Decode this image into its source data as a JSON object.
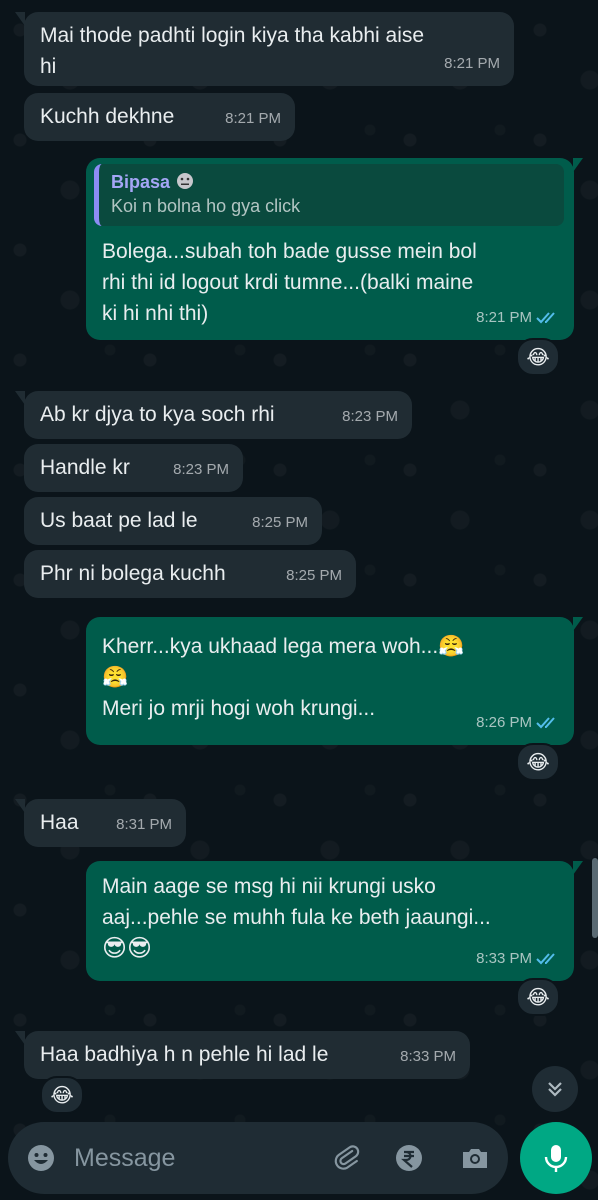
{
  "messages": [
    {
      "text": "Mai thode padhti login kiya tha kabhi aise\nhi",
      "time": "8:21 PM"
    },
    {
      "text": "Kuchh dekhne",
      "time": "8:21 PM"
    },
    {
      "quote": {
        "author": "Bipasa",
        "text": "Koi n bolna ho gya click"
      },
      "text": "Bolega...subah toh bade gusse mein bol\nrhi thi id logout krdi tumne...(balki maine\nki hi nhi thi)",
      "time": "8:21 PM",
      "reaction": "😂"
    },
    {
      "text": "Ab kr djya to kya soch rhi",
      "time": "8:23 PM"
    },
    {
      "text": "Handle kr",
      "time": "8:23 PM"
    },
    {
      "text": "Us baat pe lad le",
      "time": "8:25 PM"
    },
    {
      "text": "Phr ni bolega kuchh",
      "time": "8:25 PM"
    },
    {
      "text": "Kherr...kya ukhaad lega mera woh...",
      "text_line2": "Meri jo mrji hogi woh krungi...",
      "emoji": "😤",
      "time": "8:26 PM",
      "reaction": "😂"
    },
    {
      "text": "Haa",
      "time": "8:31 PM"
    },
    {
      "text": "Main aage se msg hi nii krungi usko\naaj...pehle se muhh fula ke beth jaaungi...",
      "emoji": "😎😎",
      "time": "8:33 PM",
      "reaction": "😂"
    },
    {
      "text": "Haa badhiya h n pehle hi lad le",
      "time": "8:33 PM",
      "reaction": "😂"
    }
  ],
  "input": {
    "placeholder": "Message"
  },
  "icons": {
    "emoji": "emoji-icon",
    "attach": "paperclip-icon",
    "payment": "rupee-icon",
    "camera": "camera-icon",
    "mic": "mic-icon",
    "scroll": "chevron-down-icon"
  },
  "colors": {
    "incoming": "#202c33",
    "outgoing": "#005c4b",
    "accent": "#00a884",
    "read_ticks": "#53bdeb"
  }
}
